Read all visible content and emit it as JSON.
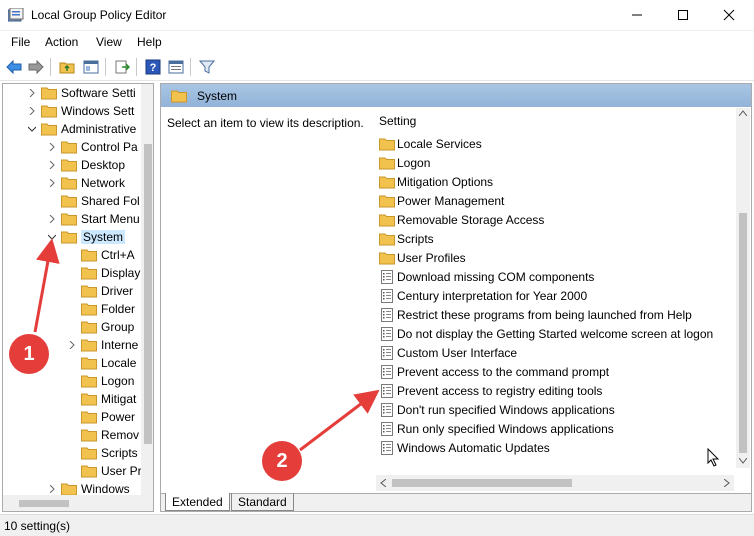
{
  "window": {
    "title": "Local Group Policy Editor"
  },
  "menu": [
    "File",
    "Action",
    "View",
    "Help"
  ],
  "tree": [
    {
      "label": "Software Setti",
      "indent": 1,
      "expander": "right"
    },
    {
      "label": "Windows Sett",
      "indent": 1,
      "expander": "right"
    },
    {
      "label": "Administrative",
      "indent": 1,
      "expander": "down"
    },
    {
      "label": "Control Pa",
      "indent": 2,
      "expander": "right"
    },
    {
      "label": "Desktop",
      "indent": 2,
      "expander": "right"
    },
    {
      "label": "Network",
      "indent": 2,
      "expander": "right"
    },
    {
      "label": "Shared Fol",
      "indent": 2,
      "expander": "none"
    },
    {
      "label": "Start Menu",
      "indent": 2,
      "expander": "right"
    },
    {
      "label": "System",
      "indent": 2,
      "expander": "down",
      "selected": true
    },
    {
      "label": "Ctrl+A",
      "indent": 3,
      "expander": "none"
    },
    {
      "label": "Display",
      "indent": 3,
      "expander": "none"
    },
    {
      "label": "Driver",
      "indent": 3,
      "expander": "none"
    },
    {
      "label": "Folder",
      "indent": 3,
      "expander": "none"
    },
    {
      "label": "Group",
      "indent": 3,
      "expander": "none"
    },
    {
      "label": "Interne",
      "indent": 3,
      "expander": "right"
    },
    {
      "label": "Locale",
      "indent": 3,
      "expander": "none"
    },
    {
      "label": "Logon",
      "indent": 3,
      "expander": "none"
    },
    {
      "label": "Mitigat",
      "indent": 3,
      "expander": "none"
    },
    {
      "label": "Power",
      "indent": 3,
      "expander": "none"
    },
    {
      "label": "Remov",
      "indent": 3,
      "expander": "none"
    },
    {
      "label": "Scripts",
      "indent": 3,
      "expander": "none"
    },
    {
      "label": "User Pr",
      "indent": 3,
      "expander": "none"
    },
    {
      "label": "Windows",
      "indent": 2,
      "expander": "right"
    }
  ],
  "right": {
    "header": "System",
    "description": "Select an item to view its description.",
    "column": "Setting",
    "items": [
      {
        "label": "Locale Services",
        "type": "folder"
      },
      {
        "label": "Logon",
        "type": "folder"
      },
      {
        "label": "Mitigation Options",
        "type": "folder"
      },
      {
        "label": "Power Management",
        "type": "folder"
      },
      {
        "label": "Removable Storage Access",
        "type": "folder"
      },
      {
        "label": "Scripts",
        "type": "folder"
      },
      {
        "label": "User Profiles",
        "type": "folder"
      },
      {
        "label": "Download missing COM components",
        "type": "setting"
      },
      {
        "label": "Century interpretation for Year 2000",
        "type": "setting"
      },
      {
        "label": "Restrict these programs from being launched from Help",
        "type": "setting"
      },
      {
        "label": "Do not display the Getting Started welcome screen at logon",
        "type": "setting"
      },
      {
        "label": "Custom User Interface",
        "type": "setting"
      },
      {
        "label": "Prevent access to the command prompt",
        "type": "setting"
      },
      {
        "label": "Prevent access to registry editing tools",
        "type": "setting"
      },
      {
        "label": "Don't run specified Windows applications",
        "type": "setting"
      },
      {
        "label": "Run only specified Windows applications",
        "type": "setting"
      },
      {
        "label": "Windows Automatic Updates",
        "type": "setting"
      }
    ],
    "tabs": [
      "Extended",
      "Standard"
    ]
  },
  "status": "10 setting(s)",
  "annotations": [
    "1",
    "2"
  ],
  "colors": {
    "folder": "#f2c24f",
    "accent_blue": "#0078d7",
    "annotation_red": "#e43d3a"
  }
}
